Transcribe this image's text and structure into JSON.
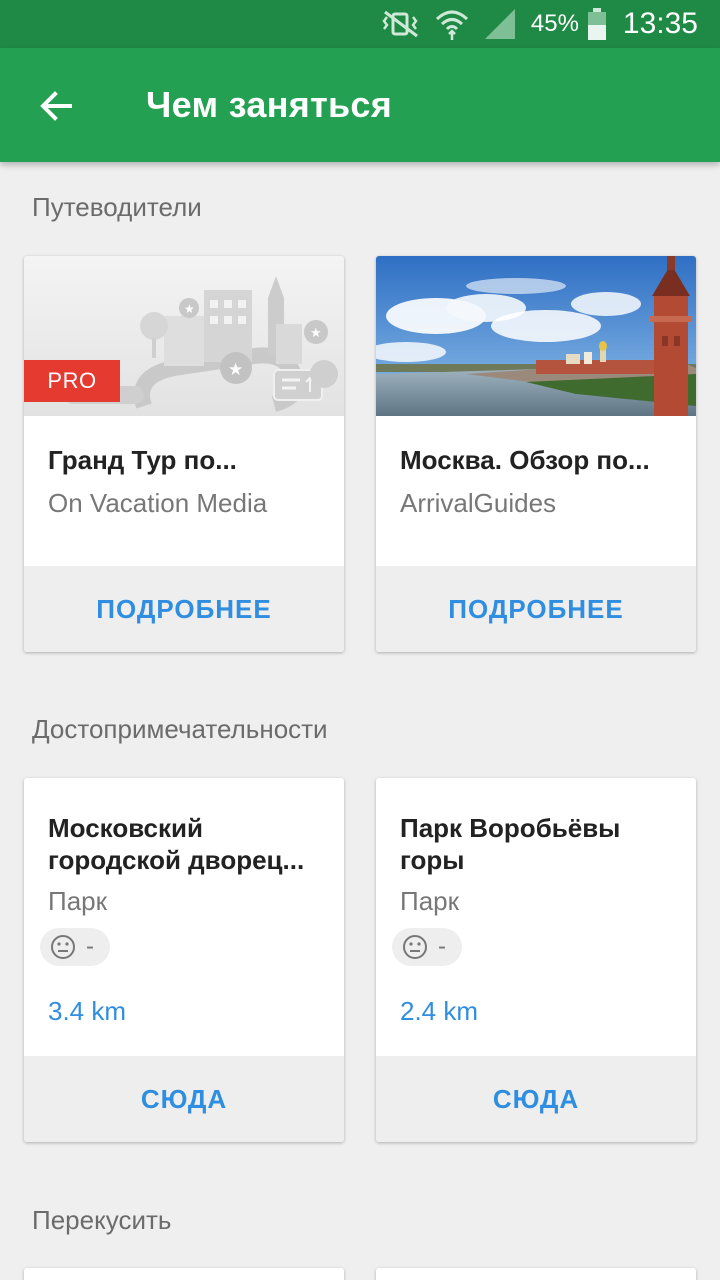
{
  "status_bar": {
    "battery_percent": "45%",
    "time": "13:35",
    "icons": [
      "mute-vibrate-icon",
      "wifi-icon",
      "cell-signal-icon",
      "battery-icon"
    ]
  },
  "app_bar": {
    "title": "Чем заняться",
    "back_icon": "arrow-back-icon"
  },
  "colors": {
    "status_bar": "#1e8a45",
    "app_bar": "#23a052",
    "accent_link": "#2f8ee0",
    "pro_badge": "#e53a2f",
    "background": "#efefef"
  },
  "sections": [
    {
      "title": "Путеводители",
      "cards": [
        {
          "name": "Гранд Тур по...",
          "subtitle": "On Vacation Media",
          "badge": "PRO",
          "action": "ПОДРОБНЕЕ",
          "image": "city-illustration"
        },
        {
          "name": "Москва. Обзор по...",
          "subtitle": "ArrivalGuides",
          "action": "ПОДРОБНЕЕ",
          "image": "kremlin-photo"
        }
      ]
    },
    {
      "title": "Достопримечательности",
      "cards": [
        {
          "name": "Московский городской дворец...",
          "subtitle": "Парк",
          "rating": "-",
          "distance": "3.4 km",
          "action": "СЮДА"
        },
        {
          "name": "Парк Воробьёвы горы",
          "subtitle": "Парк",
          "rating": "-",
          "distance": "2.4 km",
          "action": "СЮДА"
        }
      ]
    },
    {
      "title": "Перекусить"
    }
  ]
}
